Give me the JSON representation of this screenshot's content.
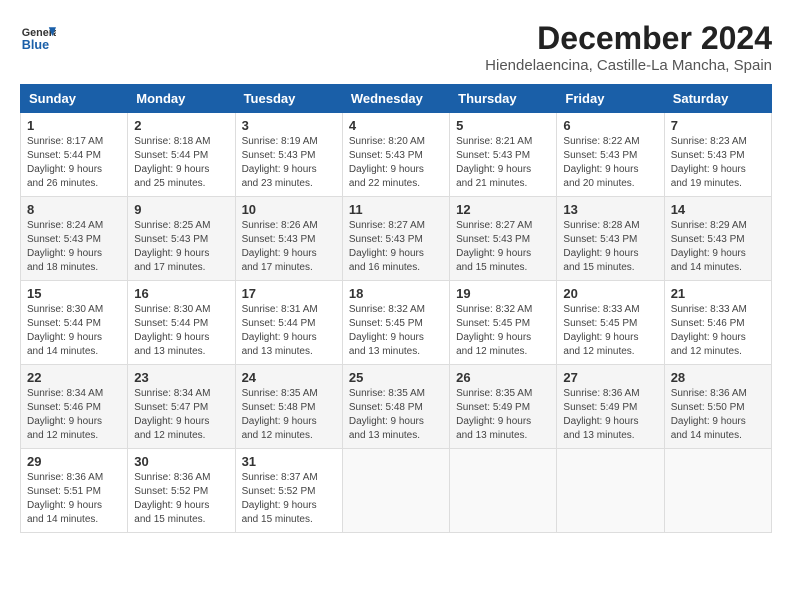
{
  "logo": {
    "general": "General",
    "blue": "Blue"
  },
  "title": "December 2024",
  "subtitle": "Hiendelaencina, Castille-La Mancha, Spain",
  "days_of_week": [
    "Sunday",
    "Monday",
    "Tuesday",
    "Wednesday",
    "Thursday",
    "Friday",
    "Saturday"
  ],
  "weeks": [
    [
      {
        "day": "1",
        "info": "Sunrise: 8:17 AM\nSunset: 5:44 PM\nDaylight: 9 hours and 26 minutes."
      },
      {
        "day": "2",
        "info": "Sunrise: 8:18 AM\nSunset: 5:44 PM\nDaylight: 9 hours and 25 minutes."
      },
      {
        "day": "3",
        "info": "Sunrise: 8:19 AM\nSunset: 5:43 PM\nDaylight: 9 hours and 23 minutes."
      },
      {
        "day": "4",
        "info": "Sunrise: 8:20 AM\nSunset: 5:43 PM\nDaylight: 9 hours and 22 minutes."
      },
      {
        "day": "5",
        "info": "Sunrise: 8:21 AM\nSunset: 5:43 PM\nDaylight: 9 hours and 21 minutes."
      },
      {
        "day": "6",
        "info": "Sunrise: 8:22 AM\nSunset: 5:43 PM\nDaylight: 9 hours and 20 minutes."
      },
      {
        "day": "7",
        "info": "Sunrise: 8:23 AM\nSunset: 5:43 PM\nDaylight: 9 hours and 19 minutes."
      }
    ],
    [
      {
        "day": "8",
        "info": "Sunrise: 8:24 AM\nSunset: 5:43 PM\nDaylight: 9 hours and 18 minutes."
      },
      {
        "day": "9",
        "info": "Sunrise: 8:25 AM\nSunset: 5:43 PM\nDaylight: 9 hours and 17 minutes."
      },
      {
        "day": "10",
        "info": "Sunrise: 8:26 AM\nSunset: 5:43 PM\nDaylight: 9 hours and 17 minutes."
      },
      {
        "day": "11",
        "info": "Sunrise: 8:27 AM\nSunset: 5:43 PM\nDaylight: 9 hours and 16 minutes."
      },
      {
        "day": "12",
        "info": "Sunrise: 8:27 AM\nSunset: 5:43 PM\nDaylight: 9 hours and 15 minutes."
      },
      {
        "day": "13",
        "info": "Sunrise: 8:28 AM\nSunset: 5:43 PM\nDaylight: 9 hours and 15 minutes."
      },
      {
        "day": "14",
        "info": "Sunrise: 8:29 AM\nSunset: 5:43 PM\nDaylight: 9 hours and 14 minutes."
      }
    ],
    [
      {
        "day": "15",
        "info": "Sunrise: 8:30 AM\nSunset: 5:44 PM\nDaylight: 9 hours and 14 minutes."
      },
      {
        "day": "16",
        "info": "Sunrise: 8:30 AM\nSunset: 5:44 PM\nDaylight: 9 hours and 13 minutes."
      },
      {
        "day": "17",
        "info": "Sunrise: 8:31 AM\nSunset: 5:44 PM\nDaylight: 9 hours and 13 minutes."
      },
      {
        "day": "18",
        "info": "Sunrise: 8:32 AM\nSunset: 5:45 PM\nDaylight: 9 hours and 13 minutes."
      },
      {
        "day": "19",
        "info": "Sunrise: 8:32 AM\nSunset: 5:45 PM\nDaylight: 9 hours and 12 minutes."
      },
      {
        "day": "20",
        "info": "Sunrise: 8:33 AM\nSunset: 5:45 PM\nDaylight: 9 hours and 12 minutes."
      },
      {
        "day": "21",
        "info": "Sunrise: 8:33 AM\nSunset: 5:46 PM\nDaylight: 9 hours and 12 minutes."
      }
    ],
    [
      {
        "day": "22",
        "info": "Sunrise: 8:34 AM\nSunset: 5:46 PM\nDaylight: 9 hours and 12 minutes."
      },
      {
        "day": "23",
        "info": "Sunrise: 8:34 AM\nSunset: 5:47 PM\nDaylight: 9 hours and 12 minutes."
      },
      {
        "day": "24",
        "info": "Sunrise: 8:35 AM\nSunset: 5:48 PM\nDaylight: 9 hours and 12 minutes."
      },
      {
        "day": "25",
        "info": "Sunrise: 8:35 AM\nSunset: 5:48 PM\nDaylight: 9 hours and 13 minutes."
      },
      {
        "day": "26",
        "info": "Sunrise: 8:35 AM\nSunset: 5:49 PM\nDaylight: 9 hours and 13 minutes."
      },
      {
        "day": "27",
        "info": "Sunrise: 8:36 AM\nSunset: 5:49 PM\nDaylight: 9 hours and 13 minutes."
      },
      {
        "day": "28",
        "info": "Sunrise: 8:36 AM\nSunset: 5:50 PM\nDaylight: 9 hours and 14 minutes."
      }
    ],
    [
      {
        "day": "29",
        "info": "Sunrise: 8:36 AM\nSunset: 5:51 PM\nDaylight: 9 hours and 14 minutes."
      },
      {
        "day": "30",
        "info": "Sunrise: 8:36 AM\nSunset: 5:52 PM\nDaylight: 9 hours and 15 minutes."
      },
      {
        "day": "31",
        "info": "Sunrise: 8:37 AM\nSunset: 5:52 PM\nDaylight: 9 hours and 15 minutes."
      },
      null,
      null,
      null,
      null
    ]
  ]
}
